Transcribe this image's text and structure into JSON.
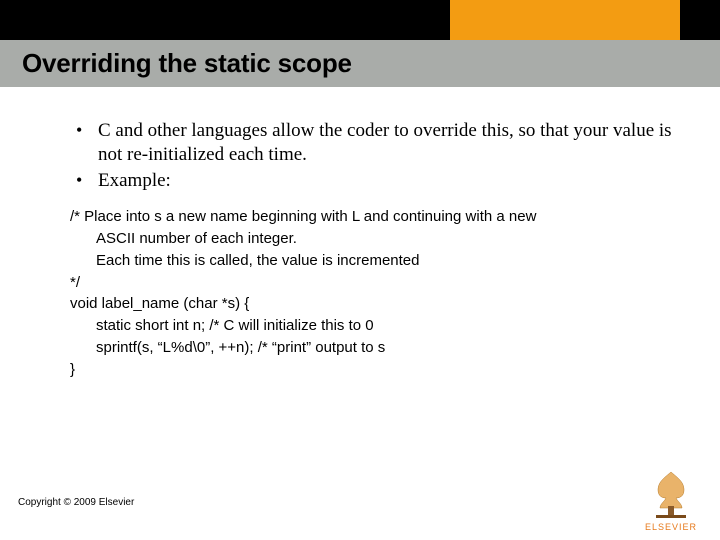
{
  "header": {
    "title": "Overriding the static scope",
    "accent_color": "#f39c12"
  },
  "bullets": [
    "C and other languages allow the coder to override this, so that your value is not re-initialized each time.",
    "Example:"
  ],
  "code": {
    "l1": "/* Place into s a new name beginning with L and continuing with a new",
    "l2": "ASCII number of each integer.",
    "l3": "Each time this is called, the value is incremented",
    "l4": "*/",
    "l5": "void label_name (char *s) {",
    "l6": "static short int n;  /* C will initialize this to 0",
    "l7": "sprintf(s, “L%d\\0”, ++n); /* “print” output to s",
    "l8": "}"
  },
  "footer": {
    "copyright": "Copyright © 2009 Elsevier",
    "logo_label": "ELSEVIER"
  }
}
